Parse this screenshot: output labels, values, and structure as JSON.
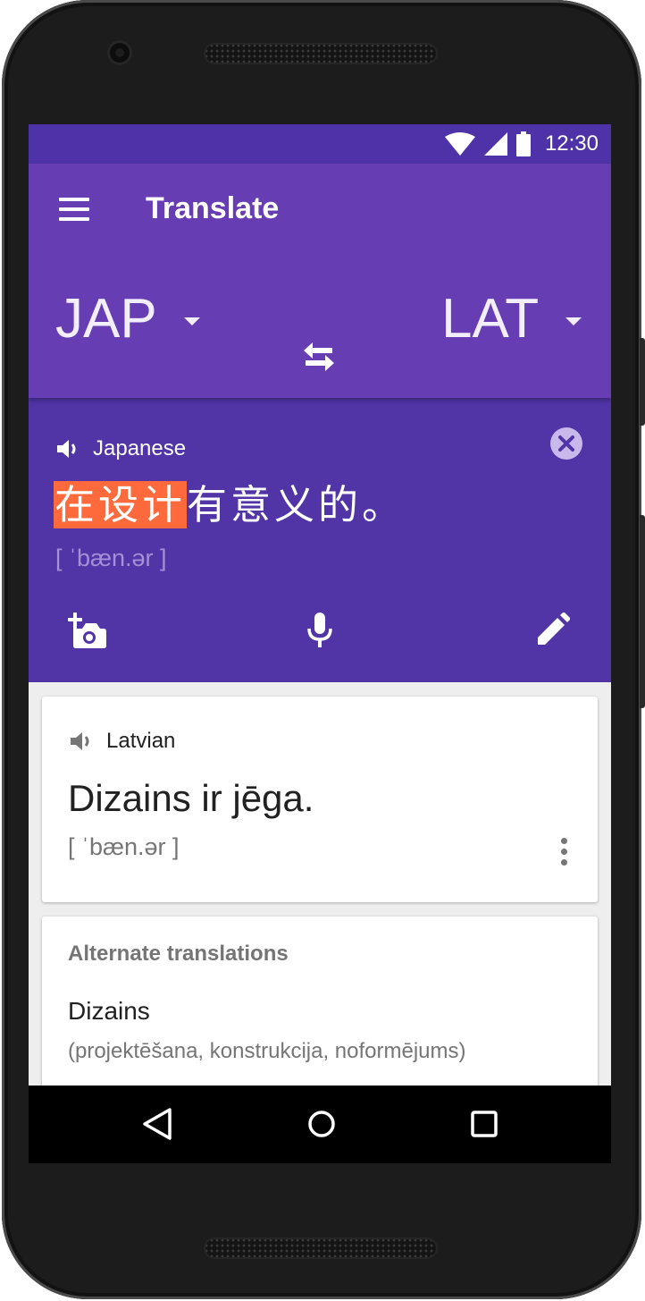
{
  "status_bar": {
    "time": "12:30"
  },
  "app_bar": {
    "title": "Translate"
  },
  "languages": {
    "source": "JAP",
    "target": "LAT"
  },
  "input": {
    "language_name": "Japanese",
    "text_highlighted": "在设计",
    "text_rest": "有意义的。",
    "phonetic": "[ ˈbæn.ər ]"
  },
  "result": {
    "language_name": "Latvian",
    "text": "Dizains ir jēga.",
    "phonetic": "[ ˈbæn.ər ]"
  },
  "alternate": {
    "heading": "Alternate translations",
    "items": [
      {
        "word": "Dizains",
        "meanings": "(projektēšana, konstrukcija, noformējums)"
      }
    ]
  },
  "colors": {
    "status_bar": "#4e33a8",
    "app_bar": "#673db3",
    "input_panel": "#5134a6",
    "highlight": "#ff6a3d"
  }
}
